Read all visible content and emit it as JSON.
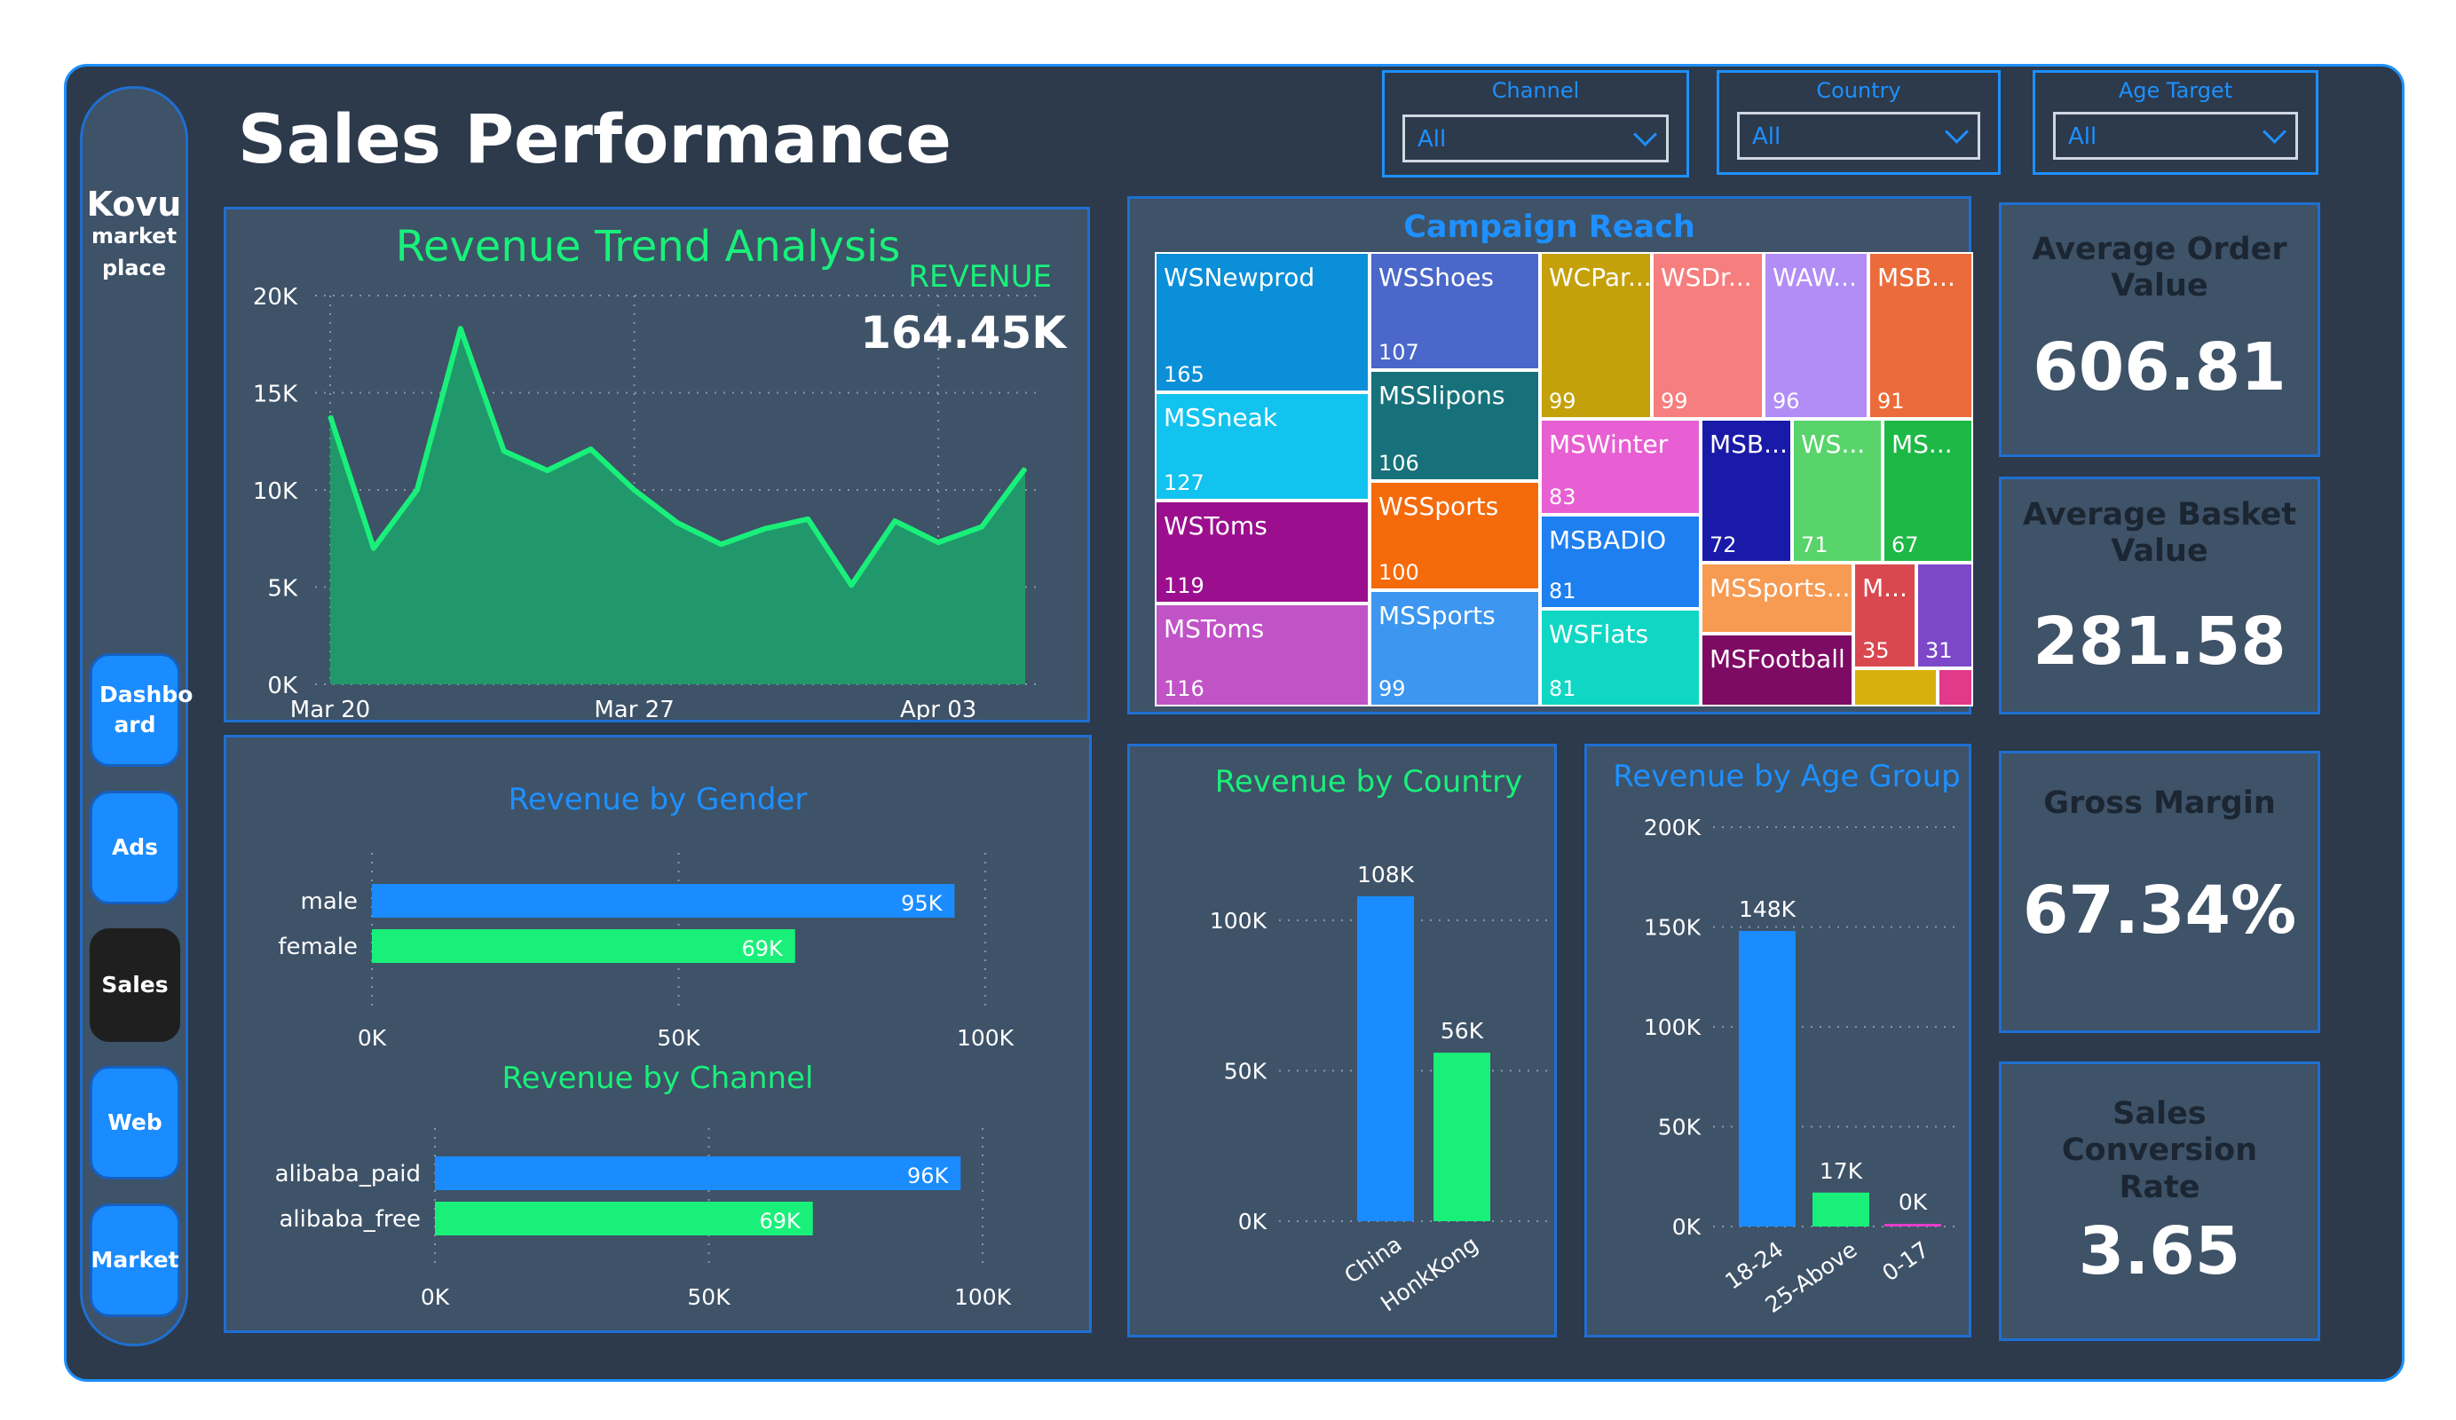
{
  "page": {
    "title": "Sales Performance"
  },
  "brand": {
    "name": "Kovu",
    "sub1": "market",
    "sub2": "place"
  },
  "nav": [
    "Dashbo ard",
    "Ads",
    "Sales",
    "Web",
    "Market"
  ],
  "nav_active": "Sales",
  "filters": [
    {
      "label": "Channel",
      "value": "All"
    },
    {
      "label": "Country",
      "value": "All"
    },
    {
      "label": "Age Target",
      "value": "All"
    }
  ],
  "kpis": [
    {
      "title": "Average Order Value",
      "value": "606.81"
    },
    {
      "title": "Average Basket Value",
      "value": "281.58"
    },
    {
      "title": "Gross Margin",
      "value": "67.34%"
    },
    {
      "title": "Sales Conversion Rate",
      "value": "3.65"
    }
  ],
  "colors": {
    "accent": "#1e90ff",
    "green": "#19f07a",
    "panel": "#3e5268",
    "background": "#2c3a4b"
  },
  "chart_data": [
    {
      "type": "area",
      "title": "Revenue Trend Analysis",
      "card_label": "REVENUE",
      "card_value": "164.45K",
      "x_ticks": [
        "Mar 20",
        "Mar 27",
        "Apr 03"
      ],
      "y_ticks": [
        "0K",
        "5K",
        "10K",
        "15K",
        "20K"
      ],
      "ylim": [
        0,
        20000
      ],
      "x": [
        "Mar 20",
        "Mar 21",
        "Mar 22",
        "Mar 23",
        "Mar 24",
        "Mar 25",
        "Mar 26",
        "Mar 27",
        "Mar 28",
        "Mar 29",
        "Mar 30",
        "Mar 31",
        "Apr 01",
        "Apr 02",
        "Apr 03",
        "Apr 04",
        "Apr 05"
      ],
      "values": [
        13800,
        7000,
        10000,
        18300,
        12000,
        11000,
        12100,
        10000,
        8300,
        7200,
        8000,
        8500,
        5100,
        8400,
        7300,
        8100,
        11100
      ],
      "color": "#19f07a"
    },
    {
      "type": "bar",
      "title": "Revenue by Gender",
      "categories": [
        "male",
        "female"
      ],
      "values": [
        95000,
        69000
      ],
      "labels": [
        "95K",
        "69K"
      ],
      "x_ticks": [
        "0K",
        "50K",
        "100K"
      ],
      "xlim": [
        0,
        100000
      ],
      "colors": [
        "#1a8cff",
        "#19f07a"
      ]
    },
    {
      "type": "bar",
      "title": "Revenue by Channel",
      "categories": [
        "alibaba_paid",
        "alibaba_free"
      ],
      "values": [
        96000,
        69000
      ],
      "labels": [
        "96K",
        "69K"
      ],
      "x_ticks": [
        "0K",
        "50K",
        "100K"
      ],
      "xlim": [
        0,
        100000
      ],
      "colors": [
        "#1a8cff",
        "#19f07a"
      ]
    },
    {
      "type": "bar",
      "title": "Revenue by Country",
      "categories": [
        "China",
        "HonkKong"
      ],
      "values": [
        108000,
        56000
      ],
      "labels": [
        "108K",
        "56K"
      ],
      "y_ticks": [
        "0K",
        "50K",
        "100K"
      ],
      "ylim": [
        0,
        110000
      ],
      "colors": [
        "#1a8cff",
        "#19f07a"
      ]
    },
    {
      "type": "bar",
      "title": "Revenue by Age Group",
      "categories": [
        "18-24",
        "25-Above",
        "0-17"
      ],
      "values": [
        148000,
        17000,
        0
      ],
      "labels": [
        "148K",
        "17K",
        "0K"
      ],
      "y_ticks": [
        "0K",
        "50K",
        "100K",
        "150K",
        "200K"
      ],
      "ylim": [
        0,
        200000
      ],
      "colors": [
        "#1a8cff",
        "#19f07a",
        "#e040c8"
      ]
    },
    {
      "type": "treemap",
      "title": "Campaign Reach",
      "items": [
        {
          "name": "WSNewprod",
          "value": "165",
          "color": "#0a8fd8"
        },
        {
          "name": "MSSneak",
          "value": "127",
          "color": "#12c3ef"
        },
        {
          "name": "WSToms",
          "value": "119",
          "color": "#9b0f8e"
        },
        {
          "name": "MSToms",
          "value": "116",
          "color": "#c054c7"
        },
        {
          "name": "WSShoes",
          "value": "107",
          "color": "#4a67c9"
        },
        {
          "name": "MSSlipons",
          "value": "106",
          "color": "#16717a"
        },
        {
          "name": "WSSports",
          "value": "100",
          "color": "#f56a0a"
        },
        {
          "name": "MSSports",
          "value": "99",
          "color": "#3d96f0"
        },
        {
          "name": "WCPar...",
          "value": "99",
          "color": "#c4a10a"
        },
        {
          "name": "WSDr...",
          "value": "99",
          "color": "#f77e7e"
        },
        {
          "name": "WAW...",
          "value": "96",
          "color": "#b18df5"
        },
        {
          "name": "MSB...",
          "value": "91",
          "color": "#eb6c3a"
        },
        {
          "name": "MSWinter",
          "value": "83",
          "color": "#e75fd2"
        },
        {
          "name": "MSBADIO",
          "value": "81",
          "color": "#1d7ff0"
        },
        {
          "name": "WSFlats",
          "value": "81",
          "color": "#10d7c4"
        },
        {
          "name": "MSB...",
          "value": "72",
          "color": "#1a1aa8"
        },
        {
          "name": "WS...",
          "value": "71",
          "color": "#58d46a"
        },
        {
          "name": "MS...",
          "value": "67",
          "color": "#1db845"
        },
        {
          "name": "MSSports...",
          "value": "",
          "color": "#f79a52"
        },
        {
          "name": "MSFootball",
          "value": "",
          "color": "#7d0a63"
        },
        {
          "name": "M...",
          "value": "35",
          "color": "#d9474f"
        },
        {
          "name": "",
          "value": "31",
          "color": "#7c48c9"
        },
        {
          "name": "",
          "value": "",
          "color": "#d8b00e"
        },
        {
          "name": "",
          "value": "",
          "color": "#e2398a"
        }
      ]
    }
  ]
}
